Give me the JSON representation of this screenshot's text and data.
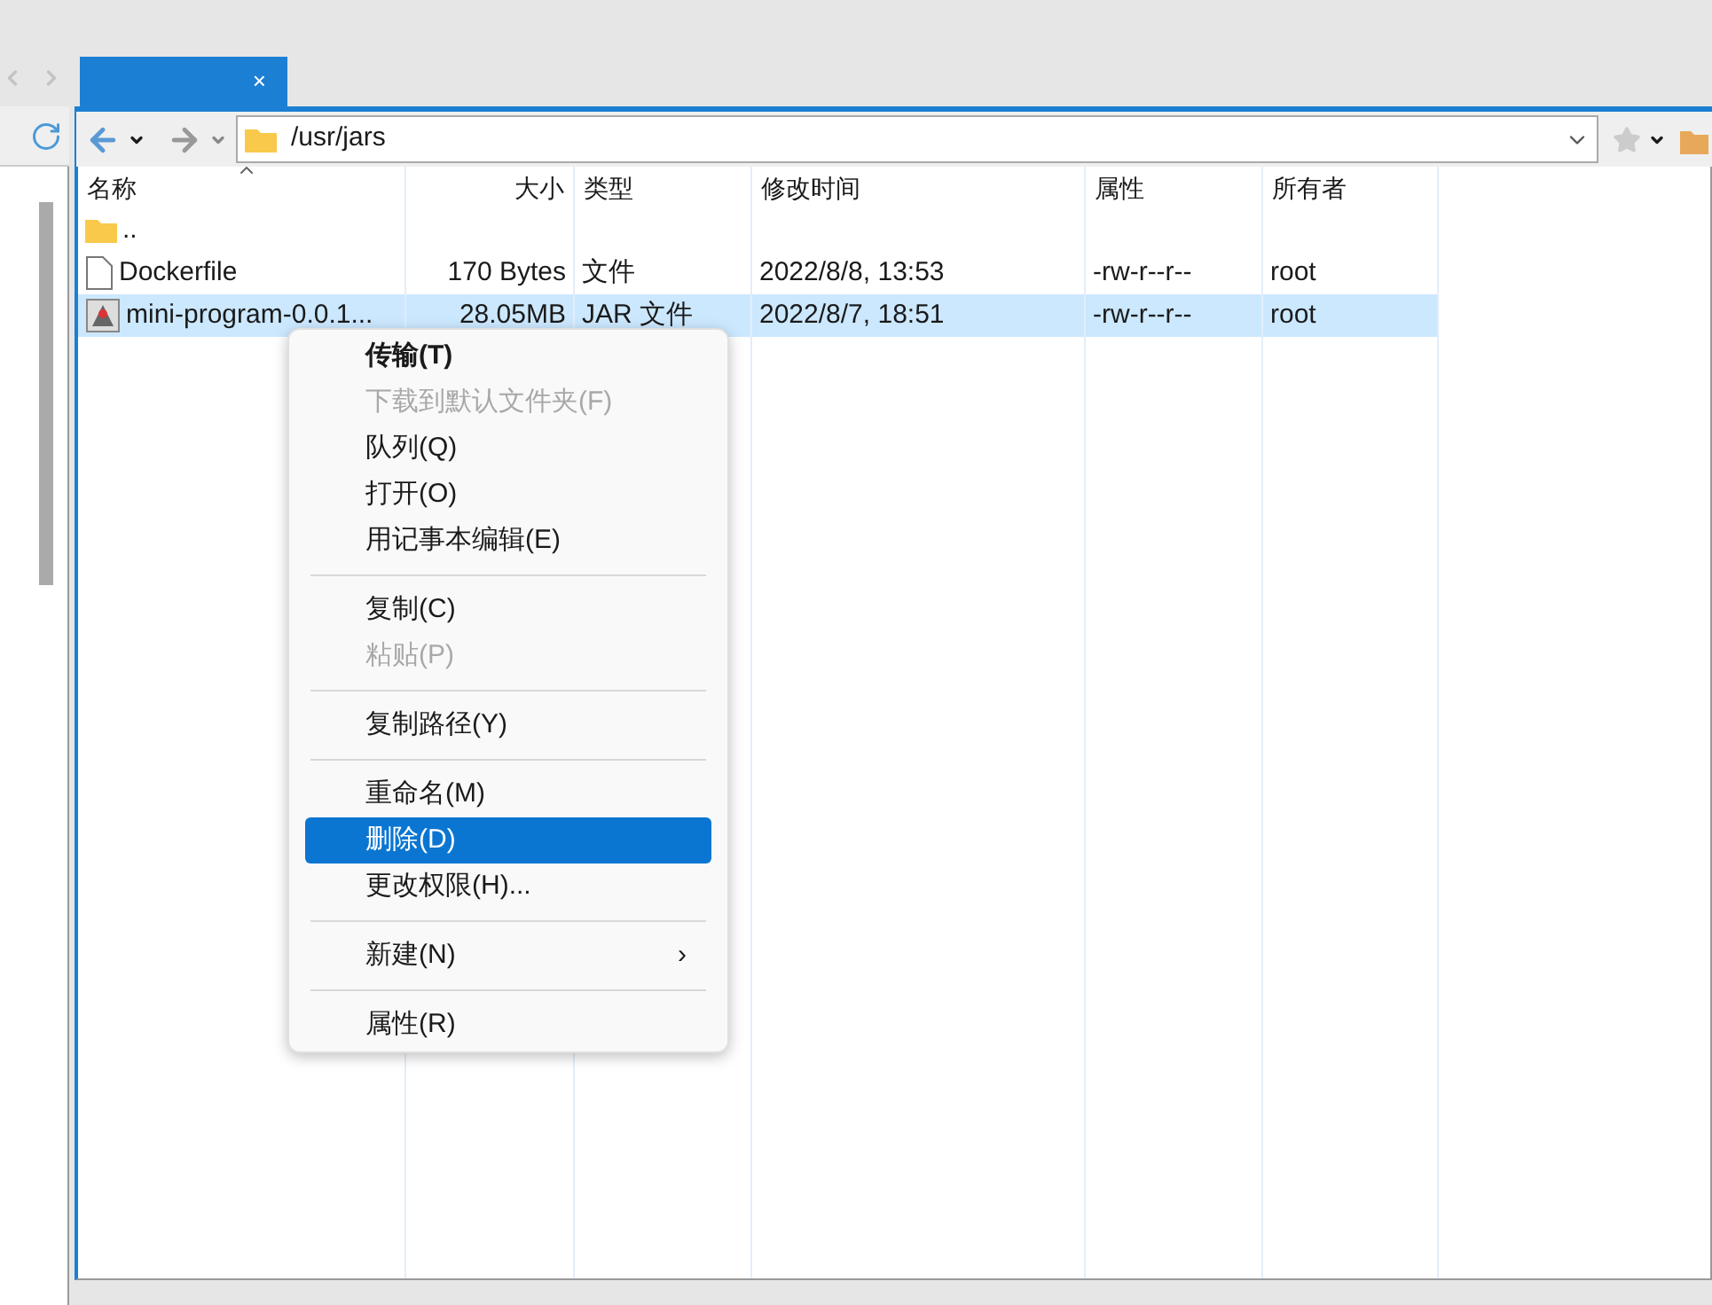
{
  "tab": {
    "selected": true,
    "close": "×"
  },
  "path": "/usr/jars",
  "columns": [
    {
      "label": "名称"
    },
    {
      "label": "大小"
    },
    {
      "label": "类型"
    },
    {
      "label": "修改时间"
    },
    {
      "label": "属性"
    },
    {
      "label": "所有者"
    }
  ],
  "rows": [
    {
      "kind": "folder",
      "selected": false,
      "cells": [
        "..",
        "",
        "",
        "",
        "",
        ""
      ]
    },
    {
      "kind": "file",
      "selected": false,
      "cells": [
        "Dockerfile",
        "170 Bytes",
        "文件",
        "2022/8/8, 13:53",
        "-rw-r--r--",
        "root"
      ]
    },
    {
      "kind": "jar",
      "selected": true,
      "cells": [
        "mini-program-0.0.1...",
        "28.05MB",
        "JAR 文件",
        "2022/8/7, 18:51",
        "-rw-r--r--",
        "root"
      ]
    }
  ],
  "context_menu": [
    {
      "kind": "item",
      "label": "传输(T)",
      "bold": true,
      "disabled": false,
      "selected": false
    },
    {
      "kind": "item",
      "label": "下载到默认文件夹(F)",
      "bold": false,
      "disabled": true,
      "selected": false
    },
    {
      "kind": "item",
      "label": "队列(Q)",
      "bold": false,
      "disabled": false,
      "selected": false
    },
    {
      "kind": "item",
      "label": "打开(O)",
      "bold": false,
      "disabled": false,
      "selected": false
    },
    {
      "kind": "item",
      "label": "用记事本编辑(E)",
      "bold": false,
      "disabled": false,
      "selected": false
    },
    {
      "kind": "separator"
    },
    {
      "kind": "item",
      "label": "复制(C)",
      "bold": false,
      "disabled": false,
      "selected": false
    },
    {
      "kind": "item",
      "label": "粘贴(P)",
      "bold": false,
      "disabled": true,
      "selected": false
    },
    {
      "kind": "separator"
    },
    {
      "kind": "item",
      "label": "复制路径(Y)",
      "bold": false,
      "disabled": false,
      "selected": false
    },
    {
      "kind": "separator"
    },
    {
      "kind": "item",
      "label": "重命名(M)",
      "bold": false,
      "disabled": false,
      "selected": false
    },
    {
      "kind": "item",
      "label": "删除(D)",
      "bold": false,
      "disabled": false,
      "selected": true
    },
    {
      "kind": "item",
      "label": "更改权限(H)...",
      "bold": false,
      "disabled": false,
      "selected": false
    },
    {
      "kind": "separator"
    },
    {
      "kind": "submenu",
      "label": "新建(N)",
      "arrow": "›",
      "bold": false,
      "disabled": false,
      "selected": false
    },
    {
      "kind": "separator"
    },
    {
      "kind": "item",
      "label": "属性(R)",
      "bold": false,
      "disabled": false,
      "selected": false
    }
  ]
}
